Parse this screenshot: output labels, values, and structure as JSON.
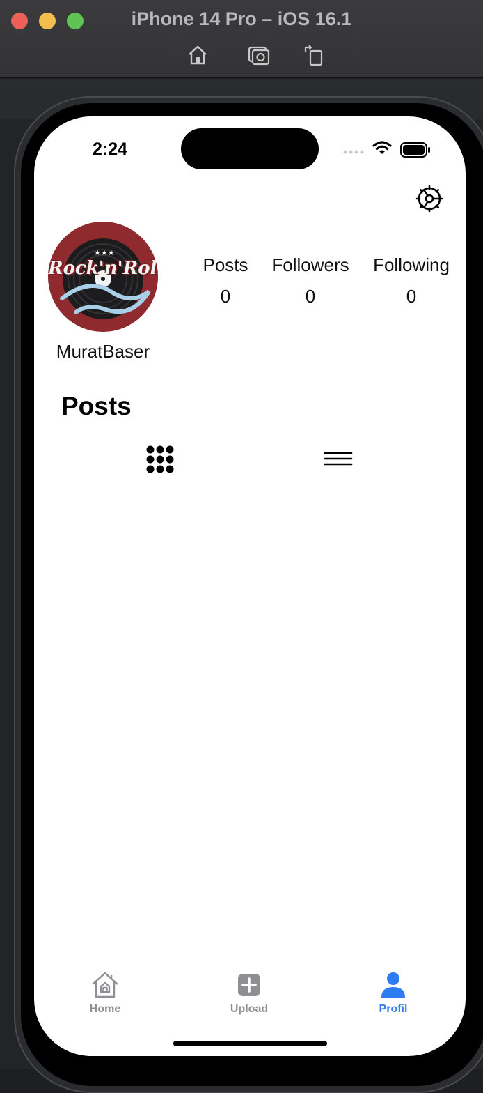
{
  "window": {
    "title": "iPhone 14 Pro – iOS 16.1",
    "toolbar": {
      "home_icon": "home-icon",
      "screenshot_icon": "camera-icon",
      "rotate_icon": "rotate-icon"
    }
  },
  "status_bar": {
    "time": "2:24"
  },
  "profile": {
    "avatar_text": "Rock'n'Roll",
    "username": "MuratBaser",
    "stats": [
      {
        "label": "Posts",
        "value": "0"
      },
      {
        "label": "Followers",
        "value": "0"
      },
      {
        "label": "Following",
        "value": "0"
      }
    ]
  },
  "posts_section": {
    "title": "Posts"
  },
  "tabbar": {
    "items": [
      {
        "label": "Home",
        "icon": "house-icon",
        "active": false
      },
      {
        "label": "Upload",
        "icon": "plus-square-icon",
        "active": false
      },
      {
        "label": "Profil",
        "icon": "person-icon",
        "active": true
      }
    ]
  },
  "colors": {
    "accent": "#2f7bf0",
    "inactive": "#8e8e93",
    "avatar_bg": "#8f2a2f"
  }
}
